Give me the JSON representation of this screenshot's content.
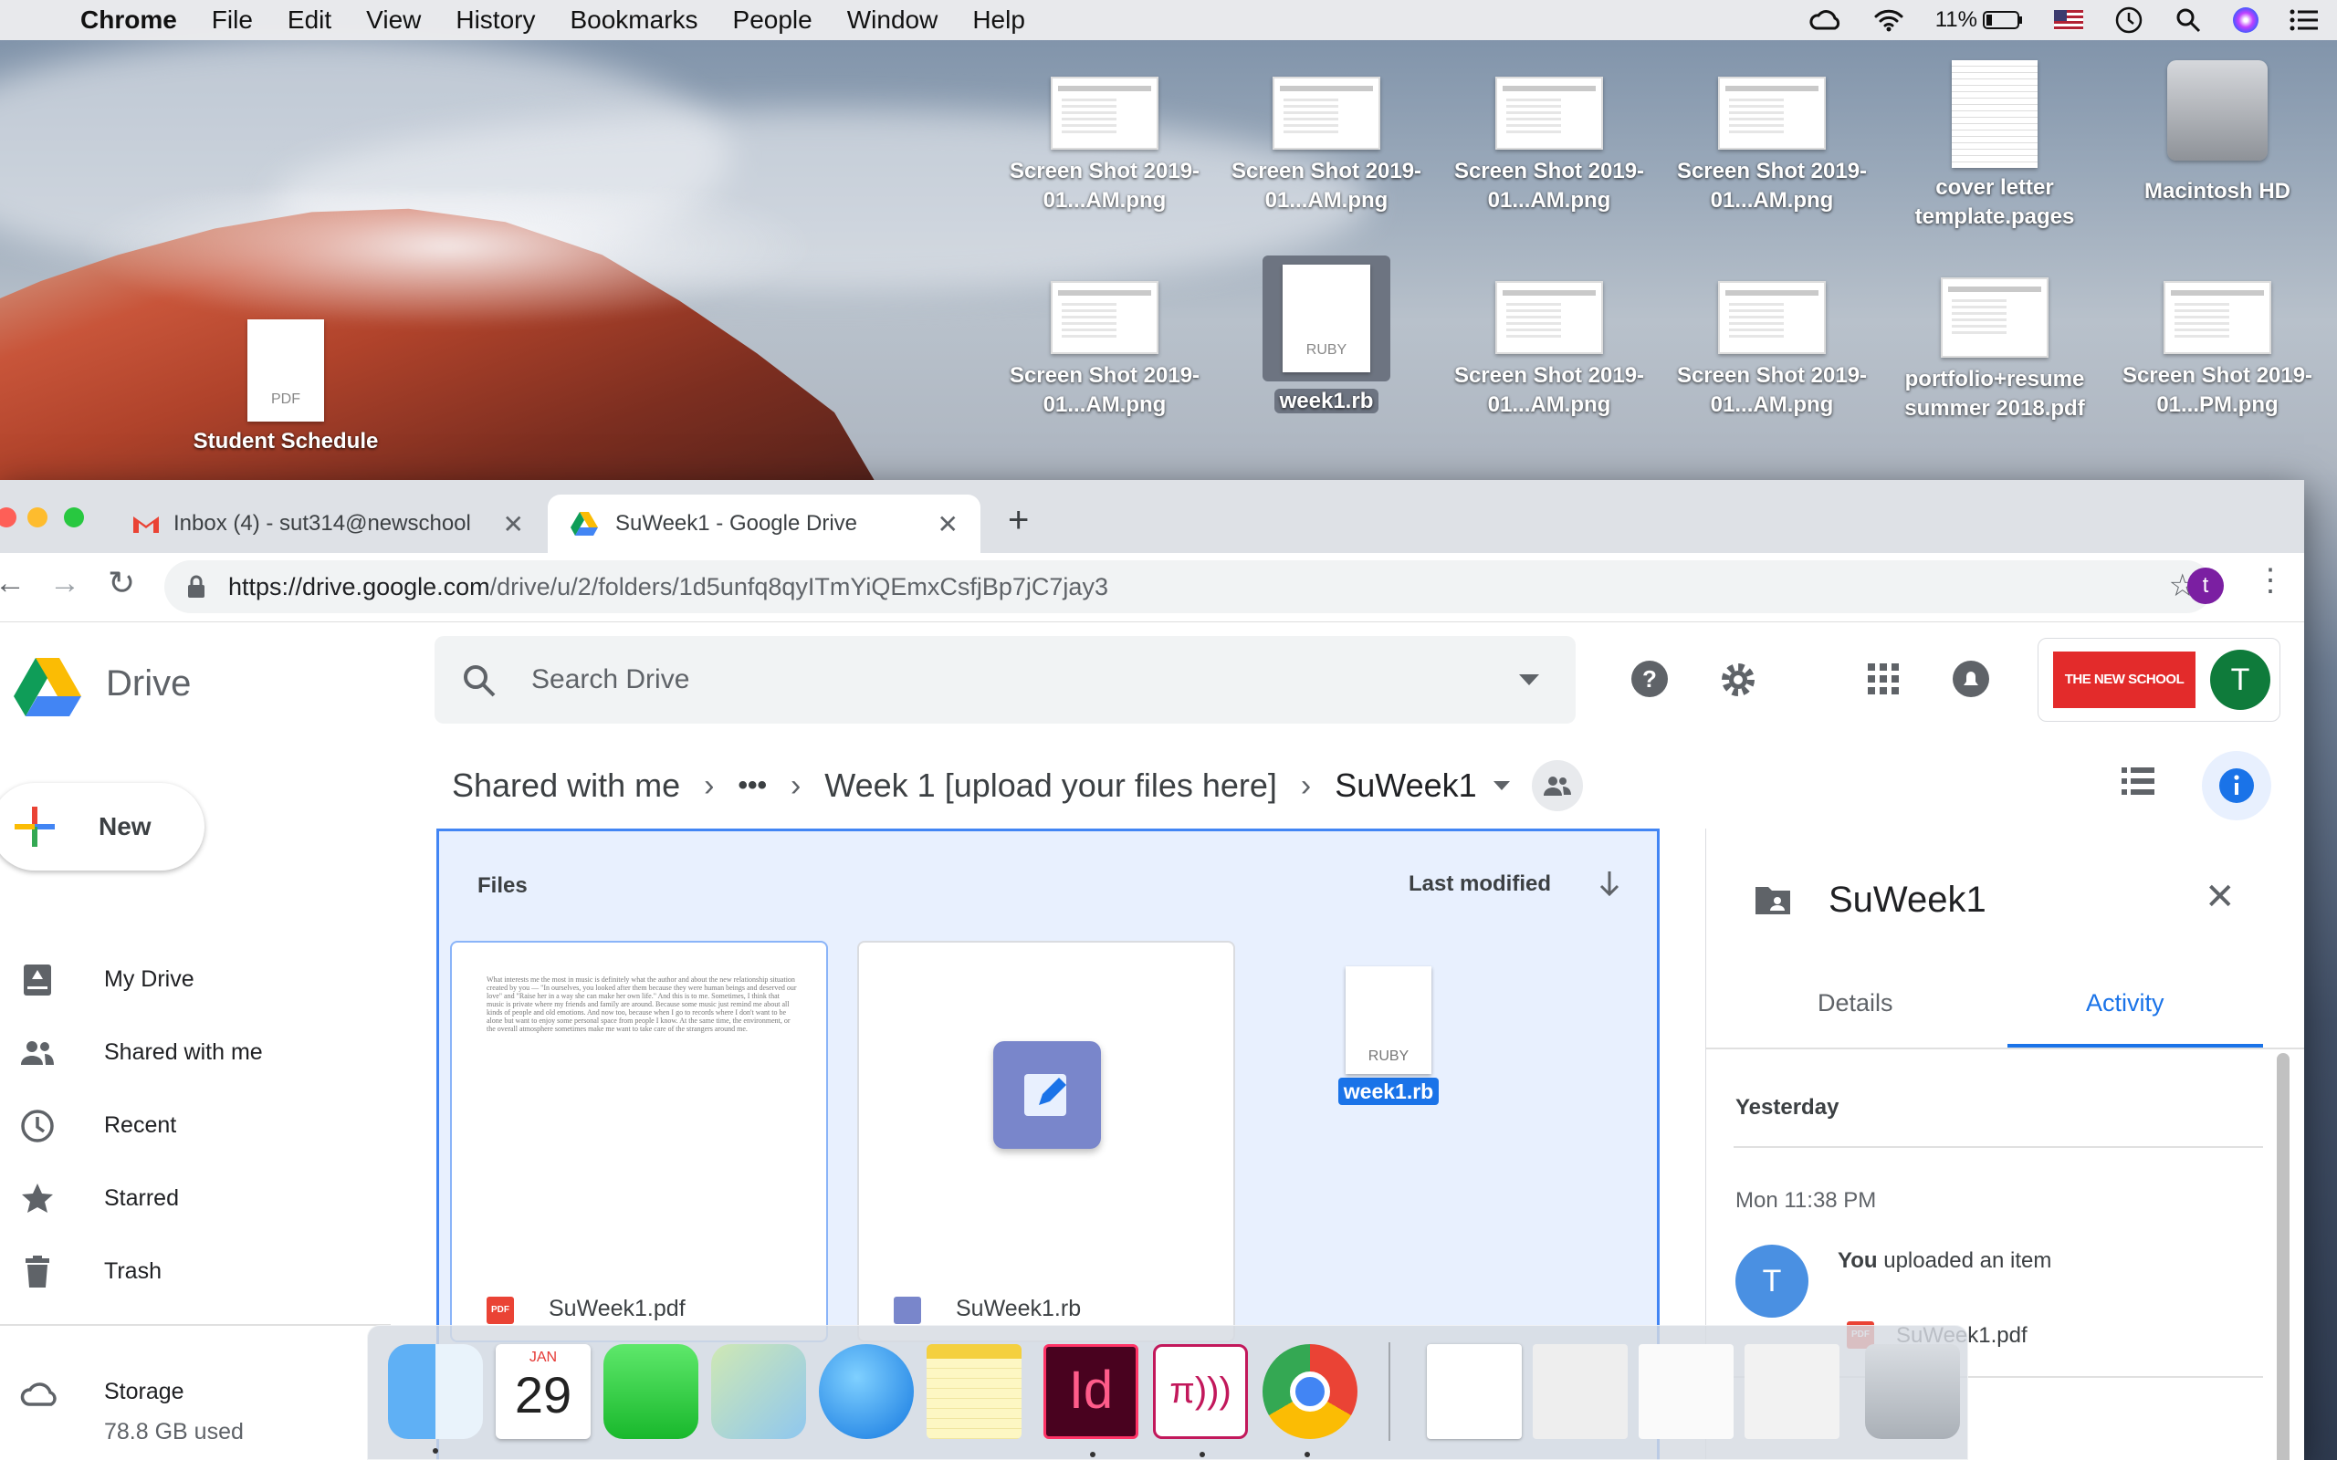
{
  "menubar": {
    "app": "Chrome",
    "items": [
      "File",
      "Edit",
      "View",
      "History",
      "Bookmarks",
      "People",
      "Window",
      "Help"
    ],
    "battery": "11%"
  },
  "desktop": {
    "icons": [
      {
        "label": "Screen Shot 2019-01...AM.png"
      },
      {
        "label": "Screen Shot 2019-01...AM.png"
      },
      {
        "label": "Screen Shot 2019-01...AM.png"
      },
      {
        "label": "Screen Shot 2019-01...AM.png"
      },
      {
        "label": "cover letter template.pages"
      },
      {
        "label": "Macintosh HD"
      },
      {
        "label": "Screen Shot 2019-01...AM.png"
      },
      {
        "label": "week1.rb",
        "badge": "RUBY"
      },
      {
        "label": "Screen Shot 2019-01...AM.png"
      },
      {
        "label": "Screen Shot 2019-01...AM.png"
      },
      {
        "label": "portfolio+resume summer 2018.pdf"
      },
      {
        "label": "Screen Shot 2019-01...PM.png"
      },
      {
        "label": "Student Schedule",
        "badge": "PDF"
      }
    ]
  },
  "browser": {
    "tabs": [
      {
        "title": "Inbox (4) - sut314@newschool"
      },
      {
        "title": "SuWeek1 - Google Drive"
      }
    ],
    "url_host": "https://drive.google.com",
    "url_path": "/drive/u/2/folders/1d5unfq8qyITmYiQEmxCsfjBp7jC7jay3",
    "profile_initial": "t"
  },
  "drive": {
    "brand": "Drive",
    "search_placeholder": "Search Drive",
    "org_logo": "THE NEW SCHOOL",
    "account_initial": "T",
    "breadcrumb": [
      "Shared with me",
      "•••",
      "Week 1 [upload your files here]",
      "SuWeek1"
    ],
    "new_label": "New",
    "nav": [
      {
        "label": "My Drive"
      },
      {
        "label": "Shared with me"
      },
      {
        "label": "Recent"
      },
      {
        "label": "Starred"
      },
      {
        "label": "Trash"
      },
      {
        "label": "Storage"
      }
    ],
    "storage_used": "78.8 GB used",
    "files_heading": "Files",
    "sort_label": "Last modified",
    "files": [
      {
        "name": "SuWeek1.pdf",
        "type_icon": "PDF"
      },
      {
        "name": "SuWeek1.rb"
      },
      {
        "name": "week1.rb",
        "badge": "RUBY"
      }
    ],
    "preview_text": "What interests me the most in music is definitely what the author and about the new relationship situation created by you — \"In ourselves, you looked after them because they were human beings and deserved our love\" and \"Raise her in a way she can make her own life.\" And this is to me. Sometimes, I think that music is private where my friends and family are around. Because some music just remind me about all kinds of people and old emotions. And now too, because when I go to records where I don't want to be alone but want to enjoy some personal space from people I know. At the same time, the environment, or the overall atmosphere sometimes make me want to take care of the strangers around me.",
    "info": {
      "title": "SuWeek1",
      "tabs": [
        "Details",
        "Activity"
      ],
      "group": "Yesterday",
      "time": "Mon 11:38 PM",
      "avatar": "T",
      "actor": "You",
      "action": " uploaded an item",
      "item": "SuWeek1.pdf",
      "item_icon": "PDF"
    }
  },
  "dock": {
    "calendar_month": "JAN",
    "calendar_day": "29",
    "indesign": "Id",
    "pi": "π)))"
  },
  "colors": {
    "accent": "#1a73e8",
    "pdf": "#ea4335",
    "newschool": "#e32b2b",
    "avatar": "#0f7b3b"
  }
}
